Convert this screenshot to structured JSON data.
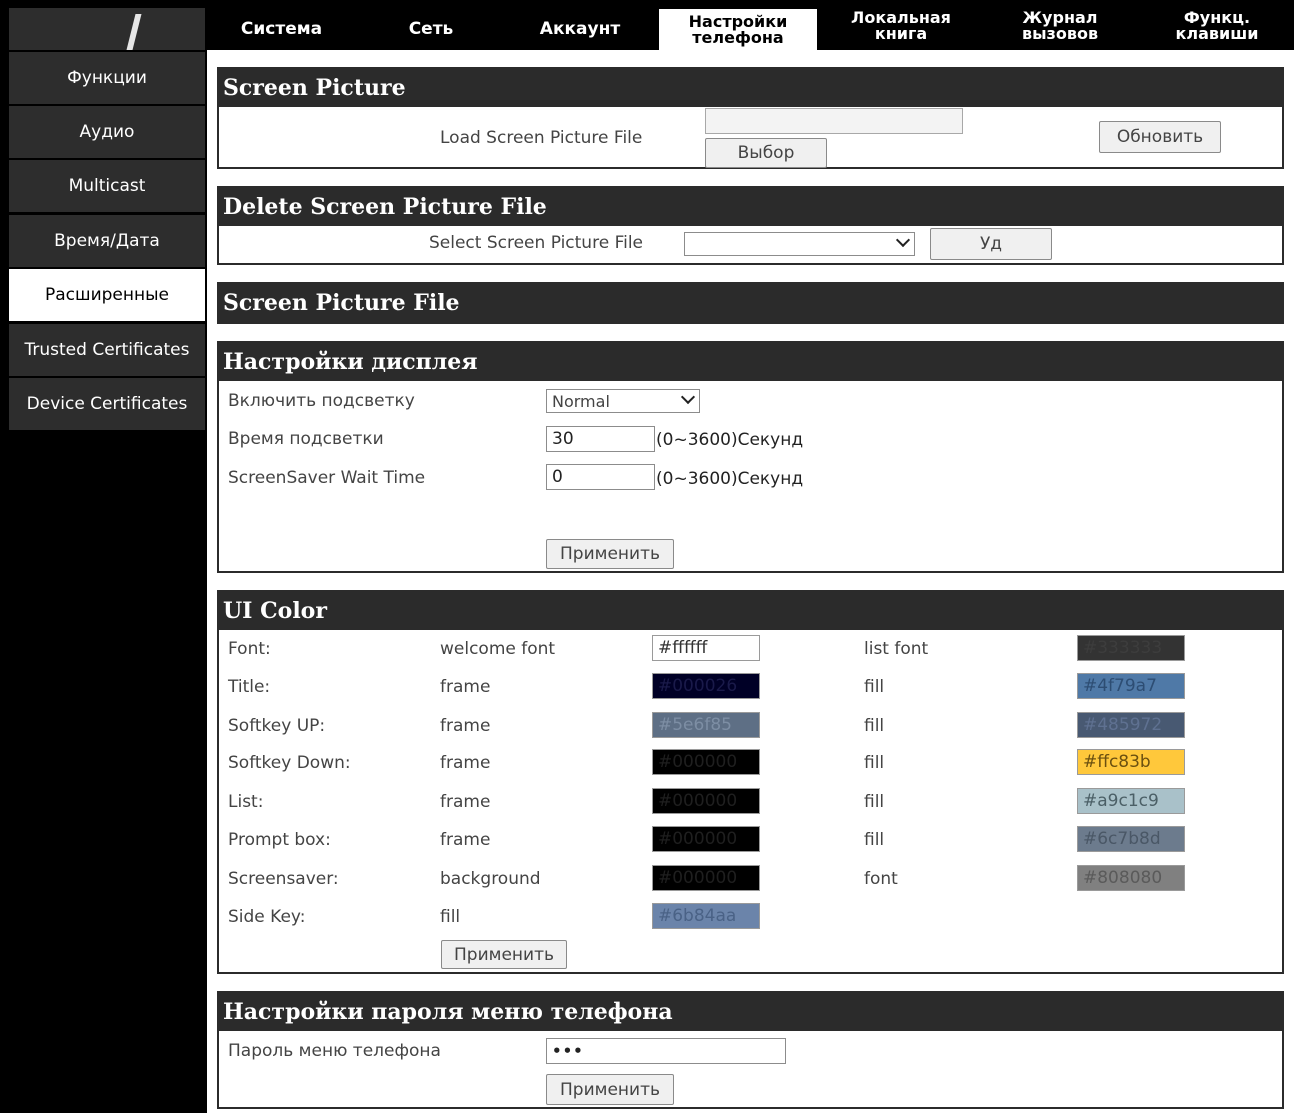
{
  "tabs": [
    {
      "label": "Система"
    },
    {
      "label": "Сеть"
    },
    {
      "label": "Аккаунт"
    },
    {
      "label": "Настройки\nтелефона",
      "active": true
    },
    {
      "label": "Локальная\nкнига"
    },
    {
      "label": "Журнал\nвызовов"
    },
    {
      "label": "Функц.\nклавиши"
    }
  ],
  "sidebar": {
    "items": [
      {
        "label": "Функции"
      },
      {
        "label": "Аудио"
      },
      {
        "label": "Multicast"
      },
      {
        "label": "Время/Дата"
      },
      {
        "label": "Расширенные",
        "active": true
      },
      {
        "label": "Trusted Certificates"
      },
      {
        "label": "Device Certificates"
      }
    ]
  },
  "screen_picture": {
    "title": "Screen Picture",
    "load_label": "Load Screen Picture File",
    "browse_button": "Выбор",
    "update_button": "Обновить"
  },
  "delete_picture": {
    "title": "Delete Screen Picture File",
    "select_label": "Select Screen Picture File",
    "select_value": "",
    "delete_button": "Уд"
  },
  "picture_file": {
    "title": "Screen Picture File"
  },
  "display": {
    "title": "Настройки дисплея",
    "backlight_label": "Включить подсветку",
    "backlight_value": "Normal",
    "backlight_time_label": "Время подсветки",
    "backlight_time_value": "30",
    "backlight_time_hint": "(0~3600)Секунд",
    "screensaver_label": "ScreenSaver Wait Time",
    "screensaver_value": "0",
    "screensaver_hint": "(0~3600)Секунд",
    "apply_button": "Применить"
  },
  "ui_color": {
    "title": "UI Color",
    "rows": [
      {
        "label": "Font:",
        "left_label": "welcome font",
        "left_value": "#ffffff",
        "left_bg": "#ffffff",
        "left_fg": "#333333",
        "right_label": "list font",
        "right_value": "#333333",
        "right_bg": "#333333",
        "right_fg": "#3d3d3d"
      },
      {
        "label": "Title:",
        "left_label": "frame",
        "left_value": "#000026",
        "left_bg": "#000026",
        "left_fg": "#1a1a4a",
        "right_label": "fill",
        "right_value": "#4f79a7",
        "right_bg": "#4f79a7",
        "right_fg": "#2d4d73"
      },
      {
        "label": "Softkey UP:",
        "left_label": "frame",
        "left_value": "#5e6f85",
        "left_bg": "#5e6f85",
        "left_fg": "#7d8ea4",
        "right_label": "fill",
        "right_value": "#485972",
        "right_bg": "#485972",
        "right_fg": "#5f7191"
      },
      {
        "label": "Softkey Down:",
        "left_label": "frame",
        "left_value": "#000000",
        "left_bg": "#000000",
        "left_fg": "#1f1f1f",
        "right_label": "fill",
        "right_value": "#ffc83b",
        "right_bg": "#ffc83b",
        "right_fg": "#6b5010"
      },
      {
        "label": "List:",
        "left_label": "frame",
        "left_value": "#000000",
        "left_bg": "#000000",
        "left_fg": "#1f1f1f",
        "right_label": "fill",
        "right_value": "#a9c1c9",
        "right_bg": "#a9c1c9",
        "right_fg": "#4b5f66"
      },
      {
        "label": "Prompt box:",
        "left_label": "frame",
        "left_value": "#000000",
        "left_bg": "#000000",
        "left_fg": "#1f1f1f",
        "right_label": "fill",
        "right_value": "#6c7b8d",
        "right_bg": "#6c7b8d",
        "right_fg": "#4a5766"
      },
      {
        "label": "Screensaver:",
        "left_label": "background",
        "left_value": "#000000",
        "left_bg": "#000000",
        "left_fg": "#1f1f1f",
        "right_label": "font",
        "right_value": "#808080",
        "right_bg": "#808080",
        "right_fg": "#5a5a5a"
      },
      {
        "label": "Side Key:",
        "left_label": "fill",
        "left_value": "#6b84aa",
        "left_bg": "#6b84aa",
        "left_fg": "#4a6286"
      }
    ],
    "apply_button": "Применить"
  },
  "password": {
    "title": "Настройки пароля меню телефона",
    "label": "Пароль меню телефона",
    "value": "•••",
    "apply_button": "Применить"
  }
}
